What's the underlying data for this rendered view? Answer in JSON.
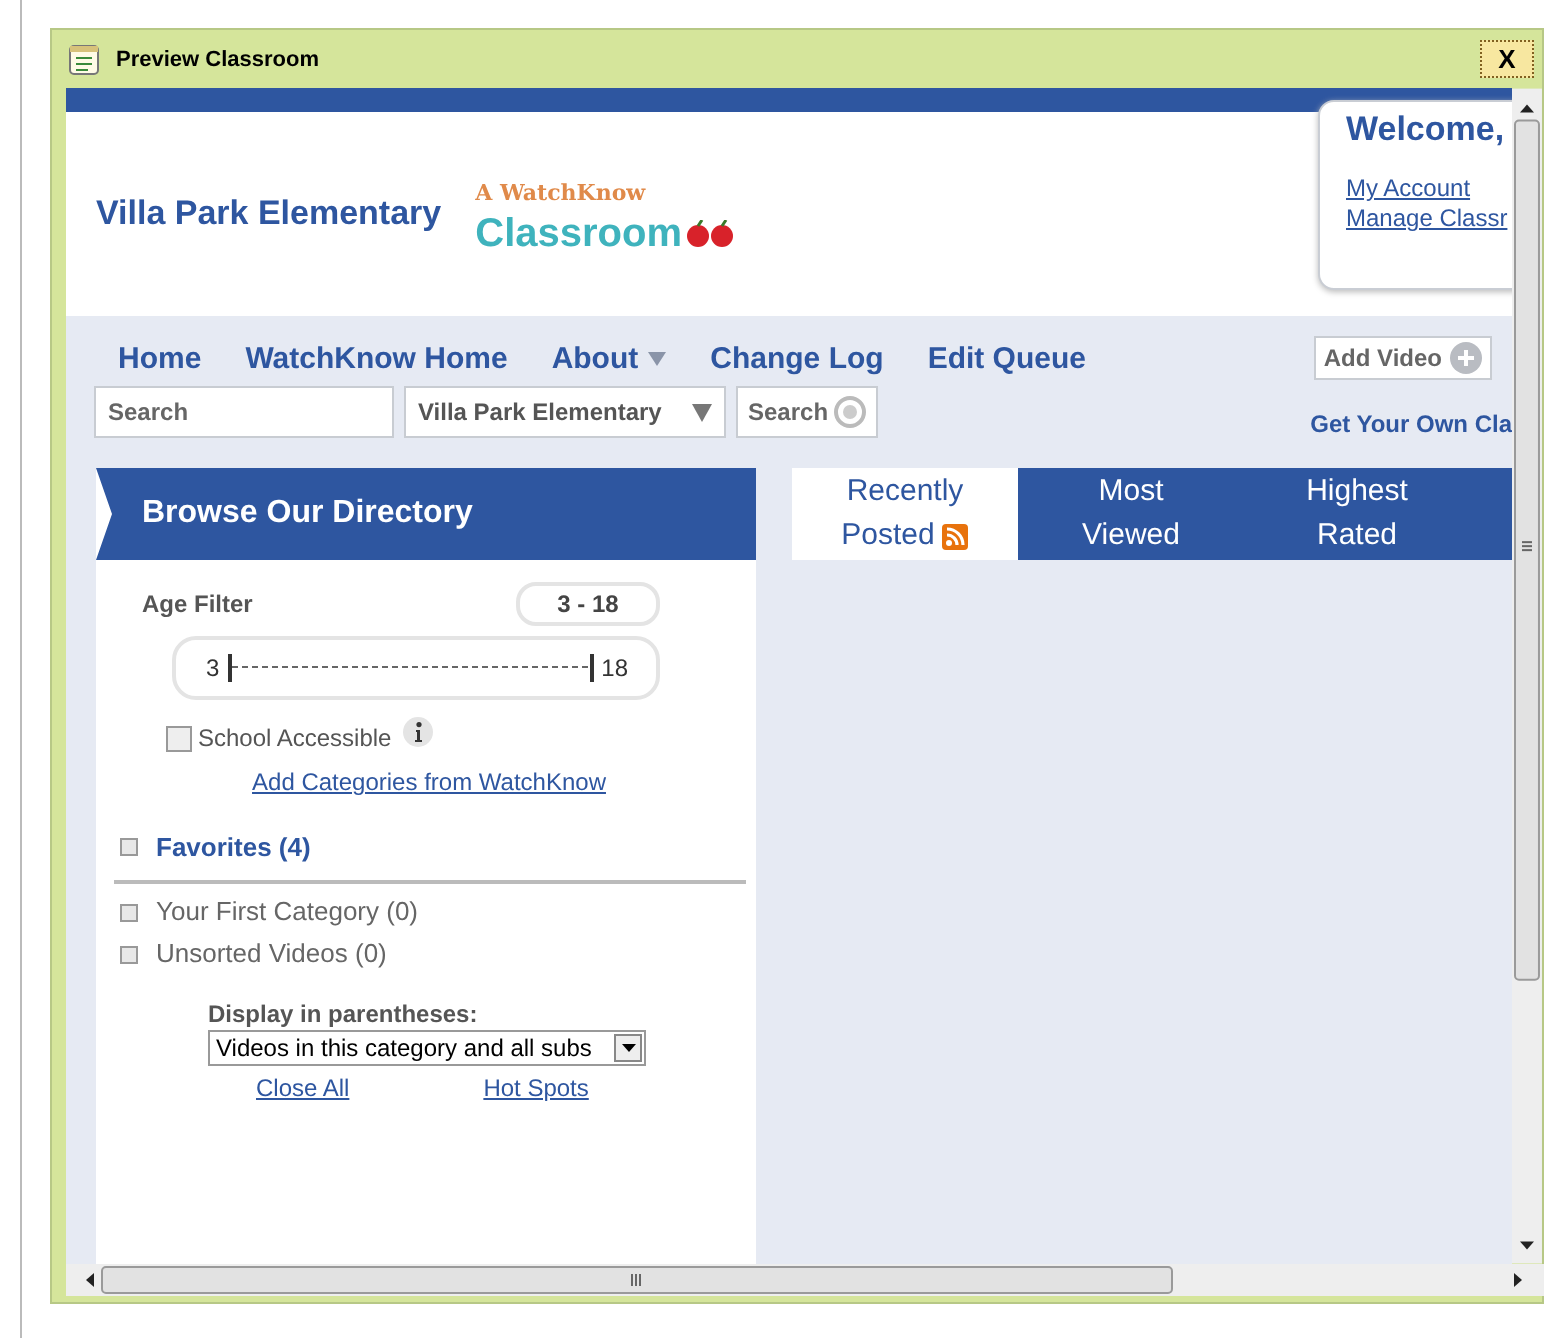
{
  "window": {
    "title": "Preview Classroom",
    "close": "X"
  },
  "header": {
    "school": "Villa Park Elementary",
    "logo_top": "A WatchKnow",
    "logo_main": "Classroom",
    "welcome": "Welcome,",
    "links": [
      "My Account",
      "Manage Classr"
    ]
  },
  "nav": {
    "items": [
      {
        "label": "Home",
        "dropdown": false
      },
      {
        "label": "WatchKnow Home",
        "dropdown": false
      },
      {
        "label": "About",
        "dropdown": true
      },
      {
        "label": "Change Log",
        "dropdown": false
      },
      {
        "label": "Edit Queue",
        "dropdown": false
      }
    ],
    "add_video": "Add Video",
    "get_own": "Get Your Own Cla"
  },
  "search": {
    "placeholder": "Search",
    "scope": "Villa Park Elementary",
    "button": "Search"
  },
  "directory": {
    "title": "Browse Our Directory",
    "age_label": "Age Filter",
    "age_range": "3 - 18",
    "age_min": "3",
    "age_max": "18",
    "school_accessible": {
      "label": "School Accessible",
      "checked": false
    },
    "add_link": "Add Categories from WatchKnow",
    "favorites": "Favorites (4)",
    "categories": [
      "Your First Category (0)",
      "Unsorted Videos (0)"
    ],
    "display_label": "Display in parentheses:",
    "display_value": "Videos in this category and all subs",
    "bottom_links": [
      "Close All",
      "Hot Spots"
    ]
  },
  "tabs": [
    {
      "lines": [
        "Recently",
        "Posted"
      ],
      "rss": true,
      "selected": true
    },
    {
      "lines": [
        "Most",
        "Viewed"
      ],
      "rss": false,
      "selected": false
    },
    {
      "lines": [
        "Highest",
        "Rated"
      ],
      "rss": false,
      "selected": false
    }
  ]
}
